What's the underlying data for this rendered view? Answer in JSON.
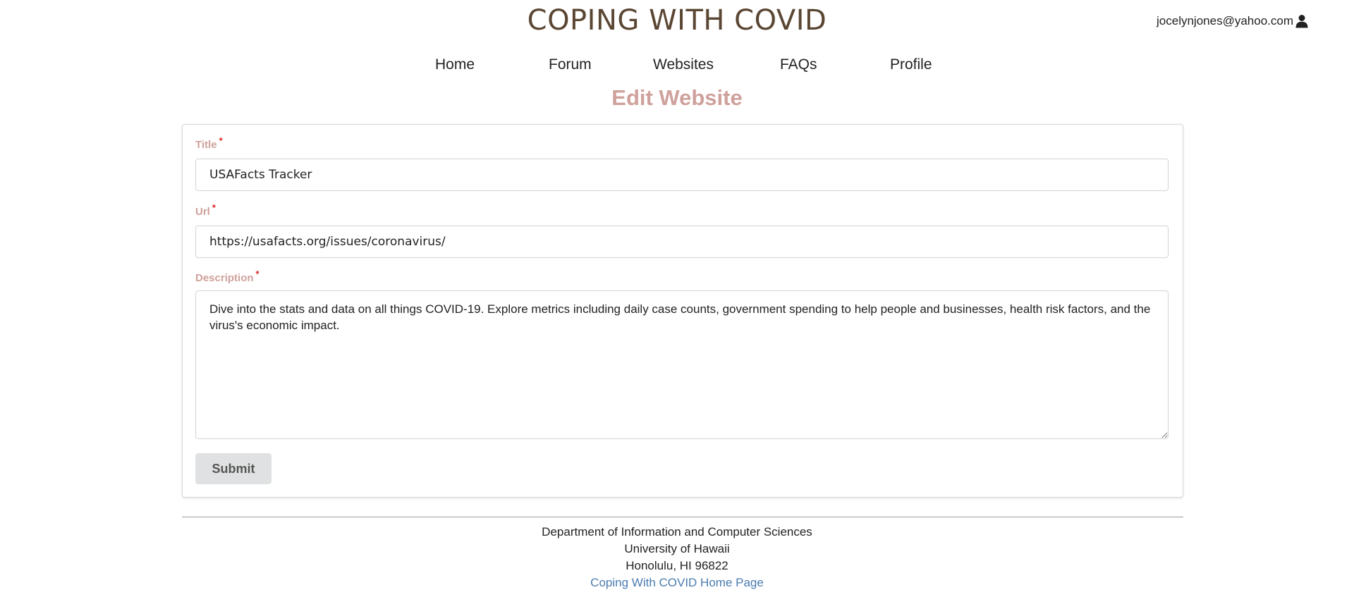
{
  "header": {
    "site_title": "COPING WITH COVID",
    "user_email": "jocelynjones@yahoo.com",
    "user_icon": "user-icon"
  },
  "nav": {
    "items": [
      {
        "label": "Home"
      },
      {
        "label": "Forum"
      },
      {
        "label": "Websites"
      },
      {
        "label": "FAQs"
      },
      {
        "label": "Profile"
      }
    ]
  },
  "page": {
    "heading": "Edit Website"
  },
  "form": {
    "title_label": "Title",
    "title_value": "USAFacts Tracker",
    "url_label": "Url",
    "url_value": "https://usafacts.org/issues/coronavirus/",
    "description_label": "Description",
    "description_value": "Dive into the stats and data on all things COVID-19. Explore metrics including daily case counts, government spending to help people and businesses, health risk factors, and the virus's economic impact.",
    "required_marker": "*",
    "submit_label": "Submit"
  },
  "footer": {
    "line1": "Department of Information and Computer Sciences",
    "line2": "University of Hawaii",
    "line3": "Honolulu, HI 96822",
    "home_link": "Coping With COVID Home Page"
  },
  "colors": {
    "title_brown": "#5a4632",
    "accent_pink": "#cfa19c",
    "required_red": "#db2828",
    "link_blue": "#4a7bb0",
    "button_gray": "#e0e1e2"
  }
}
